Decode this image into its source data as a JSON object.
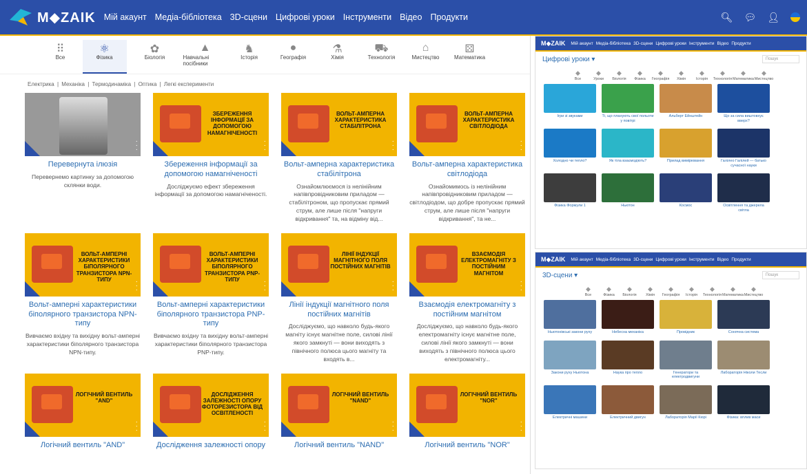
{
  "header": {
    "logo_text": "M◆ZAIK",
    "menu": [
      "Мій акаунт",
      "Медіа-бібліотека",
      "3D-сцени",
      "Цифрові уроки",
      "Інструменти",
      "Відео",
      "Продукти"
    ],
    "icons": [
      "search-icon",
      "chat-icon",
      "user-icon",
      "flag-icon"
    ]
  },
  "categories": [
    {
      "label": "Все",
      "icon": "grid-icon"
    },
    {
      "label": "Фізика",
      "icon": "atom-icon",
      "active": true
    },
    {
      "label": "Біологія",
      "icon": "plant-icon"
    },
    {
      "label": "Навчальні посібники",
      "icon": "graduation-cap-icon"
    },
    {
      "label": "Історія",
      "icon": "helmet-icon"
    },
    {
      "label": "Географія",
      "icon": "globe-icon"
    },
    {
      "label": "Хімія",
      "icon": "flask-icon"
    },
    {
      "label": "Технологія",
      "icon": "tractor-icon"
    },
    {
      "label": "Мистецтво",
      "icon": "building-icon"
    },
    {
      "label": "Математика",
      "icon": "dice-icon"
    }
  ],
  "subcategories": [
    "Електрика",
    "Механіка",
    "Термодинаміка",
    "Оптика",
    "Легкі експерименти"
  ],
  "cards": [
    {
      "thumb": "Перевернута ілюзія",
      "title": "Перевернута ілюзія",
      "desc": "Перевернемо картинку за допомогою склянки води.",
      "style": "bw",
      "label": ""
    },
    {
      "title": "Збереження інформації за допомогою намагніченості",
      "desc": "Досліджуємо ефект збереження інформації за допомогою намагніченості.",
      "style": "yellow",
      "label": "Збереження інформації за допомогою намагніченості"
    },
    {
      "title": "Вольт-амперна характеристика стабілітрона",
      "desc": "Ознайомлюємося із нелінійним напівпровідниковим приладом — стабілітроном, що пропускає прямий струм, але лише після \"напруги відкривання\" та, на відміну від...",
      "style": "yellow",
      "label": "Вольт-амперна характеристика стабілітрона"
    },
    {
      "title": "Вольт-амперна характеристика світлодіода",
      "desc": "Ознайомимось із нелінійним напівпровідниковим приладом — світлодіодом, що добре пропускає прямий струм, але лише після \"напруги відкривання\", та не...",
      "style": "yellow",
      "label": "Вольт-амперна характеристика світлодіода"
    },
    {
      "title": "Вольт-амперні характеристики біполярного транзистора NPN-типу",
      "desc": "Вивчаємо вхідну та вихідну вольт-амперні характеристики біполярного транзистора NPN-типу.",
      "style": "yellow",
      "label": "Вольт-амперні характеристики біполярного транзистора NPN-типу"
    },
    {
      "title": "Вольт-амперні характеристики біполярного транзистора PNP-типу",
      "desc": "Вивчаємо вхідну та вихідну вольт-амперні характеристики біполярного транзистора PNP-типу.",
      "style": "yellow",
      "label": "Вольт-амперні характеристики біполярного транзистора PNP-типу"
    },
    {
      "title": "Лінії індукції магнітного поля постійних магнітів",
      "desc": "Досліджуємо, що навколо будь-якого магніту існує магнітне поле, силові лінії якого замкнуті — вони виходять з північного полюса цього магніту та входять в...",
      "style": "yellow",
      "label": "Лінії індукції магнітного поля постійних магнітів"
    },
    {
      "title": "Взаємодія електромагніту з постійним магнітом",
      "desc": "Досліджуємо, що навколо будь-якого електромагніту існує магнітне поле, силові лінії якого замкнуті — вони виходять з північного полюса цього електромагніту...",
      "style": "yellow",
      "label": "Взаємодія електромагніту з постійним магнітом"
    },
    {
      "title": "Логічний вентиль \"AND\"",
      "desc": "",
      "style": "yellow",
      "label": "Логічний вентиль \"AND\""
    },
    {
      "title": "Дослідження залежності опору",
      "desc": "",
      "style": "yellow",
      "label": "Дослідження залежності опору фоторезистора від освітленості"
    },
    {
      "title": "Логічний вентиль \"NAND\"",
      "desc": "",
      "style": "yellow",
      "label": "Логічний вентиль \"NAND\""
    },
    {
      "title": "Логічний вентиль \"NOR\"",
      "desc": "",
      "style": "yellow",
      "label": "Логічний вентиль \"NOR\""
    }
  ],
  "panel1": {
    "heading": "Цифрові уроки ▾",
    "search_placeholder": "Пошук",
    "icons": [
      "Все",
      "Уроки",
      "Біологія",
      "Фізика",
      "Географія",
      "Хімія",
      "Історія",
      "Технологія",
      "Математика",
      "Мистецтво"
    ],
    "items": [
      {
        "title": "Ігри зі звуками",
        "color": "#2aa6d9"
      },
      {
        "title": "Ті, що планують свої польоти у повітрі",
        "color": "#3aa14b"
      },
      {
        "title": "Альберт Ейнштейн",
        "color": "#c88b4a"
      },
      {
        "title": "Що за сила виштовхує вверх?",
        "color": "#1d4f9e"
      },
      {
        "title": "Холодно чи тепло?",
        "color": "#1b7ac6"
      },
      {
        "title": "Як тіла взаємодіють?",
        "color": "#2bb6c8"
      },
      {
        "title": "Прилад вимірювання",
        "color": "#d8a12e"
      },
      {
        "title": "Галілео Галілей — батько сучасної науки",
        "color": "#1c3468"
      },
      {
        "title": "Фізика Формули 1",
        "color": "#3d3d3d"
      },
      {
        "title": "Ньютон",
        "color": "#2d6f3a"
      },
      {
        "title": "Космос",
        "color": "#2a3f78"
      },
      {
        "title": "Освітлення та джерела світла",
        "color": "#1f2d4a"
      }
    ]
  },
  "panel2": {
    "heading": "3D-сцени ▾",
    "search_placeholder": "Пошук",
    "icons": [
      "Все",
      "Фізика",
      "Біологія",
      "Хімія",
      "Географія",
      "Історія",
      "Технологія",
      "Математика",
      "Мистецтво"
    ],
    "items": [
      {
        "title": "Ньютонівські закони руху",
        "color": "#4f6f9e"
      },
      {
        "title": "Небесна механіка",
        "color": "#3b1d16"
      },
      {
        "title": "Провідник",
        "color": "#d8b23a"
      },
      {
        "title": "Сонячна система",
        "color": "#2c3a55"
      },
      {
        "title": "Закони руху Ньютона",
        "color": "#7ea4c0"
      },
      {
        "title": "Наука про тепло",
        "color": "#5a3b24"
      },
      {
        "title": "Генератори та електродвигуни",
        "color": "#6f7e8d"
      },
      {
        "title": "Лабораторія Ніколи Тесли",
        "color": "#9c8c72"
      },
      {
        "title": "Електричні машини",
        "color": "#3a76b8"
      },
      {
        "title": "Електричний двигун",
        "color": "#8c5a3a"
      },
      {
        "title": "Лабораторія Марії Кюрі",
        "color": "#7b6b58"
      },
      {
        "title": "Фізика: вплив маси",
        "color": "#1f2a3a"
      }
    ]
  }
}
